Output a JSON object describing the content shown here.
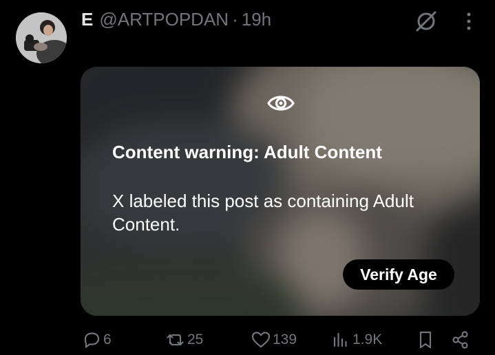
{
  "post": {
    "author_name": "E",
    "handle": "@ARTPOPDAN",
    "separator": "·",
    "time": "19h"
  },
  "icons": {
    "grok": "grok-icon",
    "more": "more-icon",
    "eye": "eye-icon"
  },
  "media": {
    "warning_title": "Content warning: Adult Content",
    "warning_text": "X labeled this post as containing Adult Content.",
    "verify_label": "Verify Age"
  },
  "actions": {
    "replies": "6",
    "reposts": "25",
    "likes": "139",
    "views": "1.9K"
  },
  "colors": {
    "background": "#000000",
    "primary_text": "#e7e9ea",
    "secondary_text": "#71767b",
    "button_bg": "#000000",
    "button_text": "#ffffff"
  }
}
